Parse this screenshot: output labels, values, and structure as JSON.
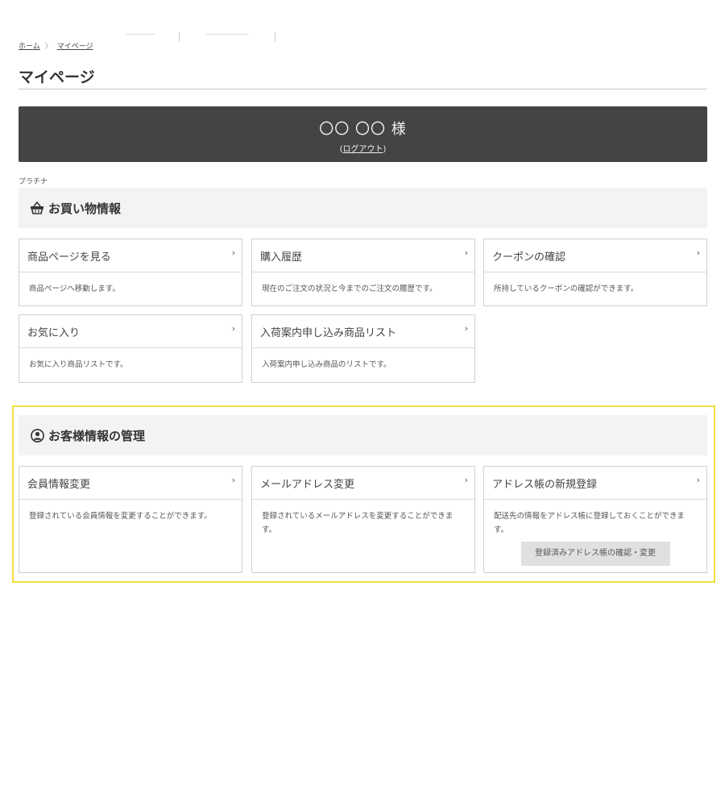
{
  "breadcrumb": {
    "home": "ホーム",
    "sep": "〉",
    "current": "マイページ"
  },
  "page_title": "マイページ",
  "member": {
    "name": "〇〇 〇〇 様",
    "logout_open": "(",
    "logout": "ログアウト",
    "logout_close": ")"
  },
  "rank": "プラチナ",
  "shopping": {
    "heading": "お買い物情報",
    "icon": "basket-icon",
    "cards": [
      {
        "title": "商品ページを見る",
        "desc": "商品ページへ移動します。"
      },
      {
        "title": "購入履歴",
        "desc": "現在のご注文の状況と今までのご注文の履歴です。"
      },
      {
        "title": "クーポンの確認",
        "desc": "所持しているクーポンの確認ができます。"
      },
      {
        "title": "お気に入り",
        "desc": "お気に入り商品リストです。"
      },
      {
        "title": "入荷案内申し込み商品リスト",
        "desc": "入荷案内申し込み商品のリストです。"
      }
    ]
  },
  "customer": {
    "heading": "お客様情報の管理",
    "icon": "user-circle-icon",
    "cards": [
      {
        "title": "会員情報変更",
        "desc": "登録されている会員情報を変更することができます。"
      },
      {
        "title": "メールアドレス変更",
        "desc": "登録されているメールアドレスを変更することができます。"
      },
      {
        "title": "アドレス帳の新規登録",
        "desc": "配送先の情報をアドレス帳に登録しておくことができます。",
        "button": "登録済みアドレス帳の確認・変更"
      }
    ]
  },
  "chevron": "›",
  "colors": {
    "banner": "#444444",
    "highlight": "#f2de3b",
    "section_bg": "#f3f3f3"
  }
}
